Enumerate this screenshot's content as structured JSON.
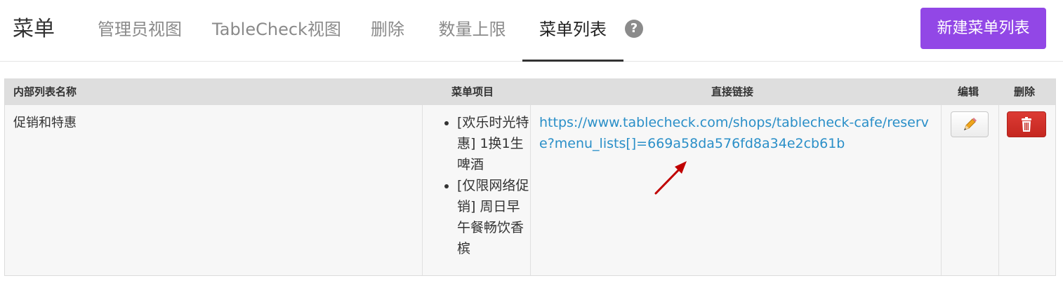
{
  "header": {
    "title": "菜单",
    "tabs": [
      {
        "label": "管理员视图",
        "active": false
      },
      {
        "label": "TableCheck视图",
        "active": false
      },
      {
        "label": "删除",
        "active": false
      },
      {
        "label": "数量上限",
        "active": false
      },
      {
        "label": "菜单列表",
        "active": true
      }
    ],
    "help_icon": "?",
    "new_button_label": "新建菜单列表"
  },
  "table": {
    "columns": [
      "内部列表名称",
      "菜单项目",
      "直接链接",
      "编辑",
      "删除"
    ],
    "rows": [
      {
        "name": "促销和特惠",
        "menu_items": [
          "[欢乐时光特惠] 1换1生啤酒",
          "[仅限网络促销] 周日早午餐畅饮香槟"
        ],
        "direct_link": "https://www.tablecheck.com/shops/tablecheck-cafe/reserve?menu_lists[]=669a58da576fd8a34e2cb61b",
        "edit_icon": "pencil-icon",
        "delete_icon": "trash-icon"
      }
    ]
  },
  "colors": {
    "accent": "#9247e6",
    "link": "#2a8fc8",
    "danger": "#d9342c",
    "annotation_arrow": "#c00000"
  }
}
